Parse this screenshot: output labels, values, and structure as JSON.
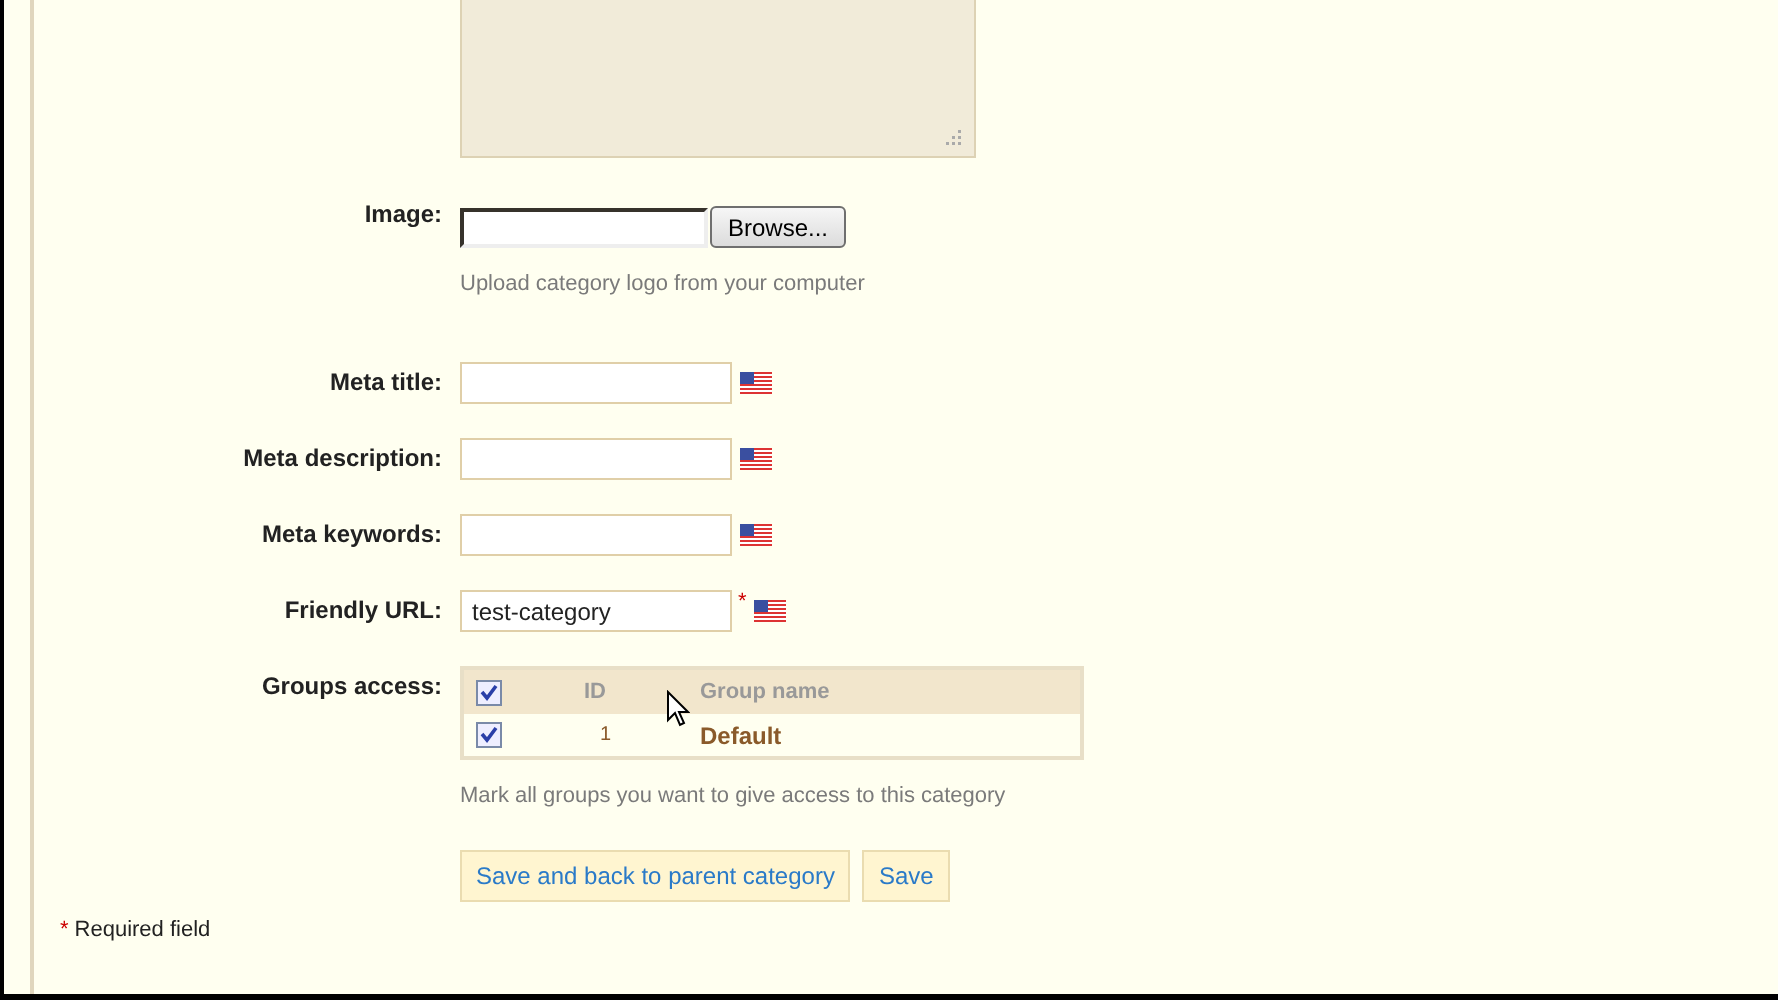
{
  "description_box": {
    "kind": "textarea"
  },
  "image": {
    "label": "Image:",
    "button": "Browse...",
    "hint": "Upload category logo from your computer"
  },
  "fields": [
    {
      "label": "Meta title:",
      "required": false
    },
    {
      "label": "Meta description:",
      "required": false
    },
    {
      "label": "Meta keywords:",
      "required": false
    },
    {
      "label": "Friendly URL:",
      "value": "test-category",
      "required": true,
      "required_mark": "*"
    }
  ],
  "groups": {
    "label": "Groups access:",
    "all_checked": true,
    "columns": [
      "ID",
      "Group name"
    ],
    "rows": [
      {
        "id": "1",
        "name": "Default",
        "checked": true
      }
    ],
    "hint": "Mark all groups you want to give access to this category"
  },
  "buttons": [
    "Save and back to parent category",
    "Save"
  ],
  "required_note": {
    "mark": "*",
    "text": "Required field"
  }
}
